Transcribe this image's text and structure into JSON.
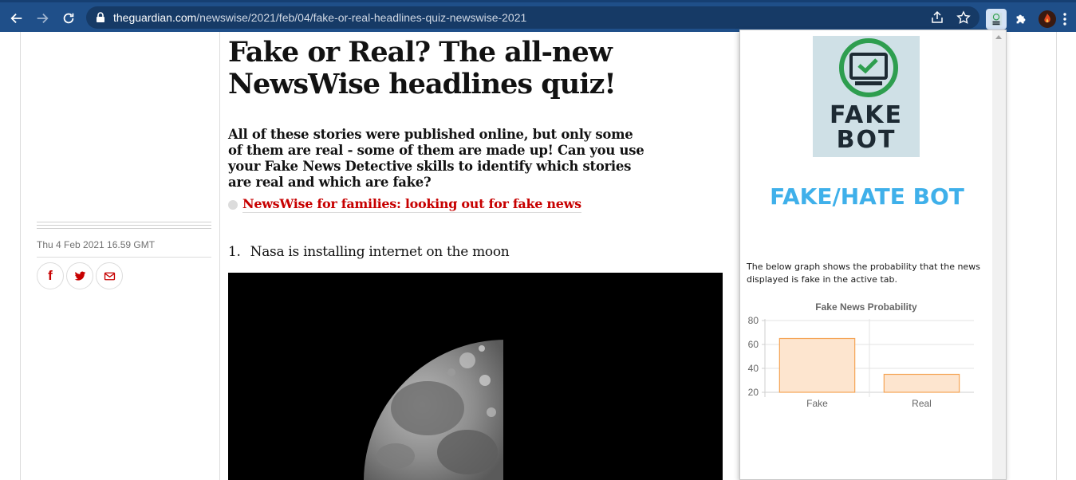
{
  "browser": {
    "url_host": "theguardian.com",
    "url_path": "/newswise/2021/feb/04/fake-or-real-headlines-quiz-newswise-2021",
    "icons": [
      "back-arrow",
      "forward-arrow",
      "reload",
      "lock",
      "share",
      "star",
      "fakebot-extension",
      "puzzle-extensions",
      "profile-avatar",
      "kebab-menu"
    ]
  },
  "article": {
    "headline": "Fake or Real? The all-new NewsWise headlines quiz!",
    "standfirst": "All of these stories were published online, but only some of them are real - some of them are made up! Can you use your Fake News Detective skills to identify which stories are real and which are fake?",
    "related_link": "NewsWise for families: looking out for fake news",
    "dateline": "Thu 4 Feb 2021 16.59 GMT",
    "share": {
      "facebook": "f",
      "twitter": "twitter",
      "email": "email"
    },
    "items": [
      {
        "number": "1.",
        "text": "Nasa is installing internet on the moon"
      }
    ]
  },
  "extension": {
    "logo_line1": "FAKE",
    "logo_line2": "BOT",
    "title": "FAKE/HATE BOT",
    "description": "The below graph shows the probability that the news displayed is fake in the active tab.",
    "colors": {
      "title": "#3fb0ea",
      "bar_fill": "#fde5cf",
      "bar_stroke": "#f5a455",
      "logo_ring": "#2e9e4f"
    }
  },
  "chart_data": {
    "type": "bar",
    "title": "Fake News Probability",
    "categories": [
      "Fake",
      "Real"
    ],
    "values": [
      65,
      35
    ],
    "ylim": [
      20,
      80
    ],
    "yticks": [
      80,
      60,
      40,
      20
    ],
    "grid": true
  }
}
